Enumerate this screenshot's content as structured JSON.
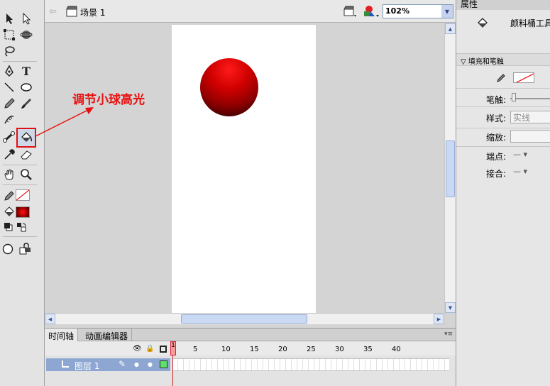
{
  "window": {
    "scene_label": "场景 1",
    "zoom": "102%"
  },
  "annotation": {
    "text": "调节小球高光",
    "color": "#e8100e"
  },
  "stage": {
    "ball_colors": [
      "#ff1a1a",
      "#d00000",
      "#900000",
      "#1a0000"
    ]
  },
  "tools": [
    "selection-tool",
    "subselection-tool",
    "free-transform-tool",
    "3d-rotation-tool",
    "lasso-tool",
    "pen-tool",
    "text-tool",
    "line-tool",
    "oval-tool",
    "pencil-tool",
    "brush-tool",
    "deco-tool",
    "bone-tool",
    "paint-bucket-tool",
    "eyedropper-tool",
    "eraser-tool",
    "hand-tool",
    "zoom-tool",
    "stroke-color",
    "fill-color",
    "swap-colors",
    "object-drawing",
    "snap-to-objects"
  ],
  "timeline": {
    "tabs": [
      "时间轴",
      "动画编辑器"
    ],
    "frame_numbers": [
      "1",
      "5",
      "10",
      "15",
      "20",
      "25",
      "30",
      "35",
      "40"
    ],
    "layer_name": "图层 1"
  },
  "properties": {
    "tab": "属性",
    "tool_name": "颜料桶工具",
    "section": "填充和笔触",
    "stroke_label": "笔触:",
    "style_label": "样式:",
    "style_value": "实线",
    "scale_label": "缩放:",
    "cap_label": "端点:",
    "join_label": "接合:"
  }
}
